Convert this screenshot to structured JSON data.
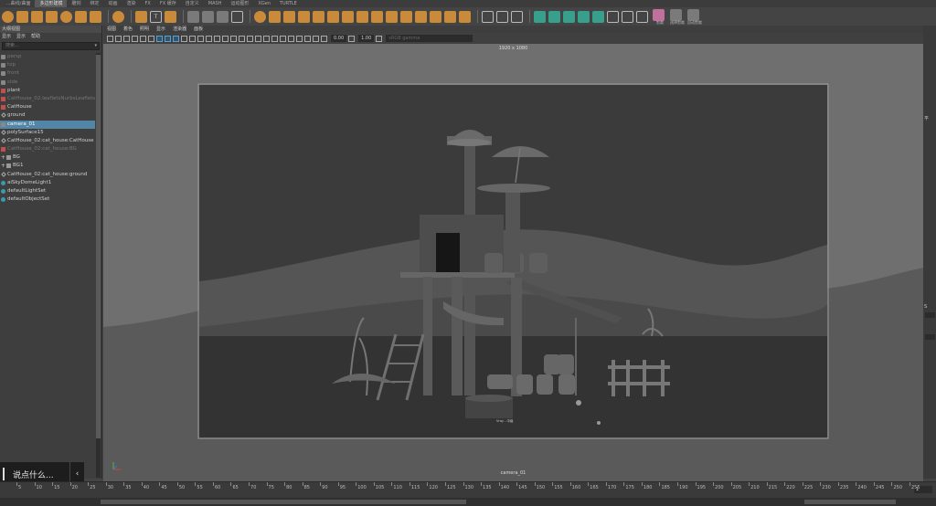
{
  "shelf": {
    "tabs": [
      "...曲线/曲面",
      "多边形建模",
      "雕刻",
      "绑定",
      "动画",
      "渲染",
      "FX",
      "FX 缓存",
      "自定义",
      "MASH",
      "运动图形",
      "XGen",
      "TURTLE"
    ],
    "active_tab": 1,
    "captions": [
      "剪裁",
      "选择剪裁",
      "自动剪裁"
    ]
  },
  "outliner": {
    "title": "大纲视图",
    "menu": [
      "显示",
      "显示",
      "帮助"
    ],
    "search_placeholder": "搜索...",
    "items": [
      {
        "label": "persp",
        "icon": "camera-icon",
        "dim": true
      },
      {
        "label": "top",
        "icon": "camera-icon",
        "dim": true
      },
      {
        "label": "front",
        "icon": "camera-icon",
        "dim": true
      },
      {
        "label": "side",
        "icon": "camera-icon",
        "dim": true
      },
      {
        "label": "plant",
        "icon": "set-icon",
        "dim": false
      },
      {
        "label": "CatHouse_02:leafletsNurbsLeafletsI",
        "icon": "set-icon",
        "dim": true
      },
      {
        "label": "CatHouse",
        "icon": "set-icon",
        "dim": false
      },
      {
        "label": "ground",
        "icon": "mesh-icon",
        "dim": false
      },
      {
        "label": "camera_01",
        "icon": "camera-icon",
        "dim": false,
        "selected": true
      },
      {
        "label": "polySurface15",
        "icon": "mesh-icon",
        "dim": false
      },
      {
        "label": "CatHouse_02:cat_house:CatHouse",
        "icon": "mesh-icon",
        "dim": false
      },
      {
        "label": "CatHouse_02:cat_house:BG",
        "icon": "set-icon",
        "dim": true
      },
      {
        "label": "BG",
        "icon": "group-icon",
        "dim": false,
        "indent": true
      },
      {
        "label": "BG1",
        "icon": "group-icon",
        "dim": false,
        "indent": true
      },
      {
        "label": "CatHouse_02:cat_house:ground",
        "icon": "mesh-icon",
        "dim": false
      },
      {
        "label": "aiSkyDomeLight1",
        "icon": "light-icon",
        "dim": false
      },
      {
        "label": "defaultLightSet",
        "icon": "light-icon",
        "dim": false
      },
      {
        "label": "defaultObjectSet",
        "icon": "light-icon",
        "dim": false
      }
    ]
  },
  "viewport": {
    "menu": [
      "视图",
      "着色",
      "照明",
      "显示",
      "渲染器",
      "面板"
    ],
    "field_a": "0.00",
    "field_b": "1.00",
    "colorspace": "sRGB gamma",
    "resolution": "1920 x 1080",
    "camera_label": "camera_01",
    "vray_tag": "Vray - 中级"
  },
  "chat": {
    "placeholder": "说点什么...",
    "collapse": "‹"
  },
  "timeline": {
    "ticks": [
      5,
      10,
      15,
      20,
      25,
      30,
      35,
      40,
      45,
      50,
      55,
      60,
      65,
      70,
      75,
      80,
      85,
      90,
      95,
      100,
      105,
      110,
      115,
      120,
      125,
      130,
      135,
      140,
      145,
      150,
      155,
      160,
      165,
      170,
      175,
      180,
      185,
      190,
      195,
      200,
      205,
      210,
      215,
      220,
      225,
      230,
      235,
      240,
      245,
      250,
      255
    ],
    "current_frame": "1"
  },
  "right_strip": {
    "labels": [
      "平",
      "S"
    ]
  },
  "colors": {
    "selection": "#5285a6",
    "shelf_icon": "#c98a3a",
    "viewport_bg": "#6e6e6e"
  }
}
